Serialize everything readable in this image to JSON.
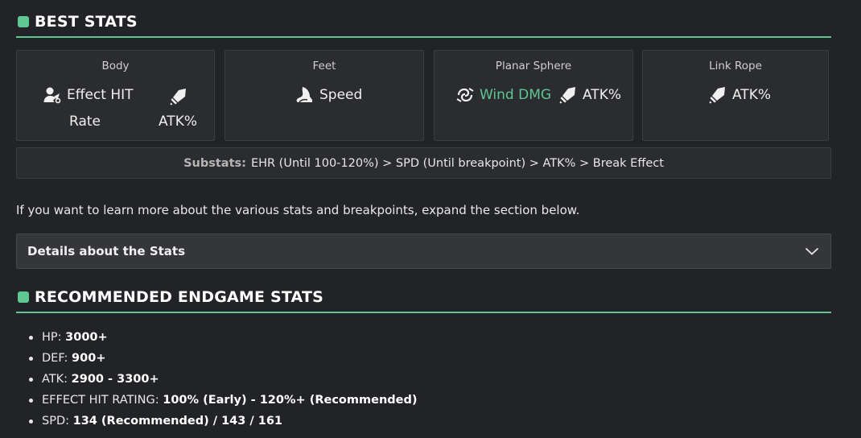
{
  "best_stats": {
    "heading": "BEST STATS",
    "slots": [
      {
        "slot": "Body",
        "stats": [
          {
            "icon": "effect-hit-rate-icon",
            "line1": "Effect HIT",
            "line2": "Rate"
          },
          {
            "icon": "atk-sword-icon",
            "label": "ATK%"
          }
        ]
      },
      {
        "slot": "Feet",
        "stats": [
          {
            "icon": "speed-boot-icon",
            "label": "Speed"
          }
        ]
      },
      {
        "slot": "Planar Sphere",
        "stats": [
          {
            "icon": "wind-icon",
            "label": "Wind DMG"
          },
          {
            "icon": "atk-sword-icon",
            "label": "ATK%"
          }
        ]
      },
      {
        "slot": "Link Rope",
        "stats": [
          {
            "icon": "atk-sword-icon",
            "label": "ATK%"
          }
        ]
      }
    ],
    "substats_label": "Substats:",
    "substats_value": "EHR (Until 100-120%) > SPD (Until breakpoint) > ATK% > Break Effect"
  },
  "intro_text": "If you want to learn more about the various stats and breakpoints, expand the section below.",
  "accordion": {
    "title": "Details about the Stats",
    "icon": "chevron-down-icon"
  },
  "recommended": {
    "heading": "RECOMMENDED ENDGAME STATS",
    "items": [
      {
        "label": "HP:",
        "value": "3000+"
      },
      {
        "label": "DEF:",
        "value": "900+"
      },
      {
        "label": "ATK:",
        "value": "2900 - 3300+"
      },
      {
        "label": "EFFECT HIT RATING:",
        "value": "100% (Early) - 120%+ (Recommended)"
      },
      {
        "label": "SPD:",
        "value": "134 (Recommended) / 143 / 161"
      }
    ]
  },
  "colors": {
    "accent": "#5ec792",
    "background": "#222326",
    "panel": "#2b2c2f"
  }
}
